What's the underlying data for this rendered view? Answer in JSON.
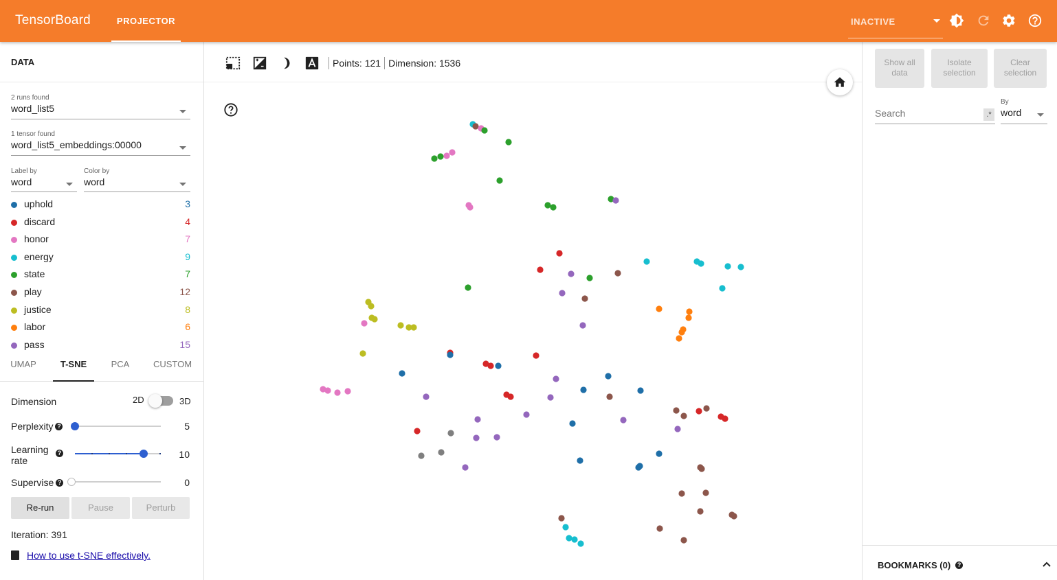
{
  "header": {
    "brand": "TensorBoard",
    "tab": "PROJECTOR",
    "run_status": "INACTIVE",
    "icons": [
      "brightness-icon",
      "refresh-icon",
      "settings-icon",
      "help-icon"
    ]
  },
  "left": {
    "data_title": "DATA",
    "runs": {
      "label": "2 runs found",
      "value": "word_list5"
    },
    "tensor": {
      "label": "1 tensor found",
      "value": "word_list5_embeddings:00000"
    },
    "label_by": {
      "label": "Label by",
      "value": "word"
    },
    "color_by": {
      "label": "Color by",
      "value": "word"
    },
    "legend": [
      {
        "name": "uphold",
        "count": "3",
        "color": "#1f6fa8"
      },
      {
        "name": "discard",
        "count": "4",
        "color": "#d62728"
      },
      {
        "name": "honor",
        "count": "7",
        "color": "#e377c2"
      },
      {
        "name": "energy",
        "count": "9",
        "color": "#17becf"
      },
      {
        "name": "state",
        "count": "7",
        "color": "#2ca02c"
      },
      {
        "name": "play",
        "count": "12",
        "color": "#8c564b"
      },
      {
        "name": "justice",
        "count": "8",
        "color": "#bcbd22"
      },
      {
        "name": "labor",
        "count": "6",
        "color": "#ff7f0e"
      },
      {
        "name": "pass",
        "count": "15",
        "color": "#9467bd"
      }
    ],
    "algo_tabs": [
      "UMAP",
      "T-SNE",
      "PCA",
      "CUSTOM"
    ],
    "active_tab": "T-SNE",
    "dimension": {
      "label": "Dimension",
      "left": "2D",
      "right": "3D",
      "value": "2D"
    },
    "perplexity": {
      "label": "Perplexity",
      "value": "5",
      "fraction": 0.0
    },
    "learning_rate": {
      "label_1": "Learning",
      "label_2": "rate",
      "value": "10",
      "fraction": 0.8
    },
    "supervise": {
      "label": "Supervise",
      "value": "0",
      "fraction": 0.0
    },
    "buttons": {
      "rerun": "Re-run",
      "pause": "Pause",
      "perturb": "Perturb"
    },
    "iteration": "Iteration: 391",
    "howto_link": "How to use t-SNE effectively."
  },
  "center": {
    "stats": {
      "points": "Points: 121",
      "dimension": "Dimension: 1536"
    }
  },
  "right": {
    "buttons": {
      "show_all": [
        "Show all",
        "data"
      ],
      "isolate": [
        "Isolate",
        "selection"
      ],
      "clear": [
        "Clear",
        "selection"
      ]
    },
    "search_placeholder": "Search",
    "regex": ".*",
    "by": {
      "label": "By",
      "value": "word"
    },
    "bookmarks": "BOOKMARKS (0)"
  }
}
